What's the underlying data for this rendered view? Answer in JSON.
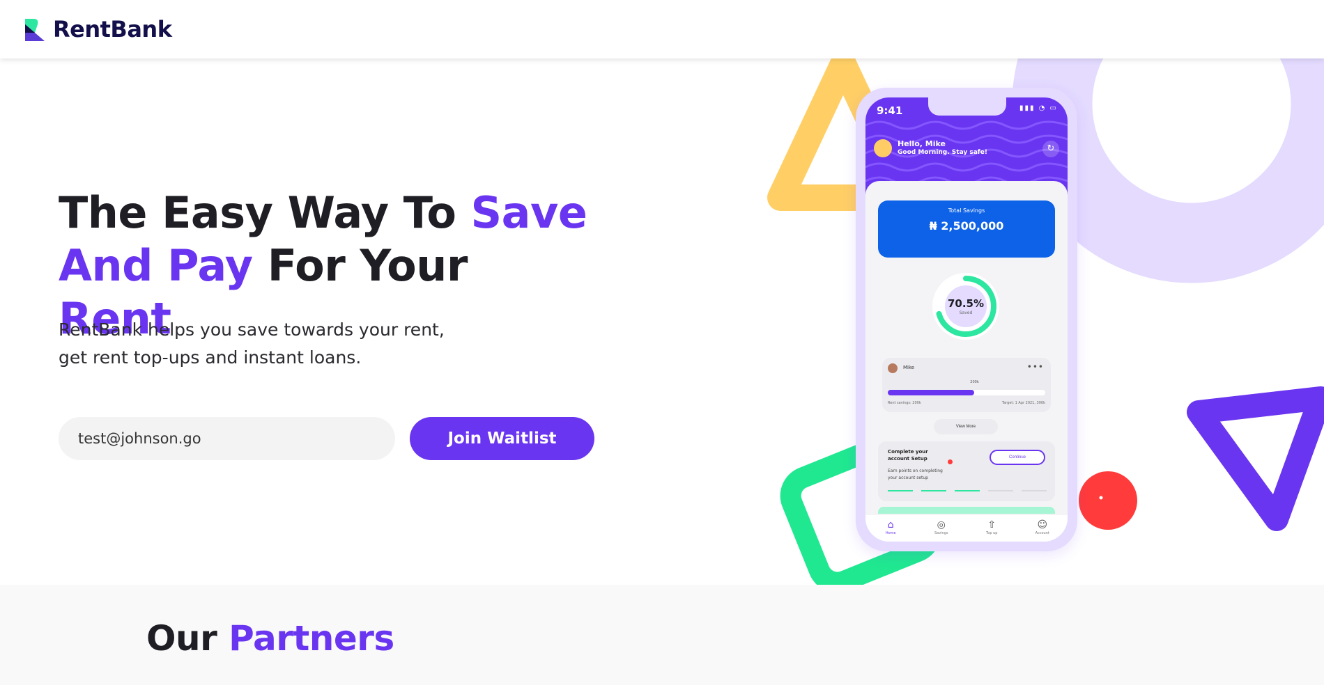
{
  "brand": {
    "name": "RentBank"
  },
  "hero": {
    "title_part1": "The Easy Way To ",
    "title_accent1": "Save",
    "title_accent2": "And Pay",
    "title_part2": " For Your ",
    "title_accent3": "Rent",
    "subtitle_line1": "RentBank helps you save towards your rent,",
    "subtitle_line2": "get rent top-ups and instant loans.",
    "email_value": "test@johnson.go",
    "join_label": "Join Waitlist"
  },
  "phone": {
    "time": "9:41",
    "greeting_name": "Hello, Mike",
    "greeting_sub": "Good Morning. Stay safe!",
    "savings_label": "Total Savings",
    "savings_amount": "₦ 2,500,000",
    "progress_percent": "70.5%",
    "progress_value": 0.705,
    "progress_label": "Saved",
    "goal_name": "Mike",
    "goal_fill": 0.55,
    "goal_marker": "200k",
    "goal_left": "Rent savings: 200k",
    "goal_right": "Target: 1 Apr 2021, 300k",
    "view_more": "View More",
    "setup_title": "Complete your account Setup",
    "setup_continue": "Continue",
    "setup_desc": "Earn points on completing your account setup",
    "tabs": [
      {
        "label": "Home",
        "icon": "home-icon",
        "active": true
      },
      {
        "label": "Savings",
        "icon": "piggy-bank-icon",
        "active": false
      },
      {
        "label": "Top up",
        "icon": "top-up-icon",
        "active": false
      },
      {
        "label": "Account",
        "icon": "account-icon",
        "active": false
      }
    ]
  },
  "partners": {
    "title_part1": "Our ",
    "title_accent": "Partners"
  },
  "colors": {
    "accent": "#6a35f0",
    "dark": "#1e1e24",
    "logo_green": "#2de6a0",
    "yellow_shape": "#ffcf66",
    "lavender_shape": "#e4dbff",
    "green_shape": "#20e890",
    "red_dot": "#ff3b3b",
    "savings_blue": "#0d62e8"
  }
}
